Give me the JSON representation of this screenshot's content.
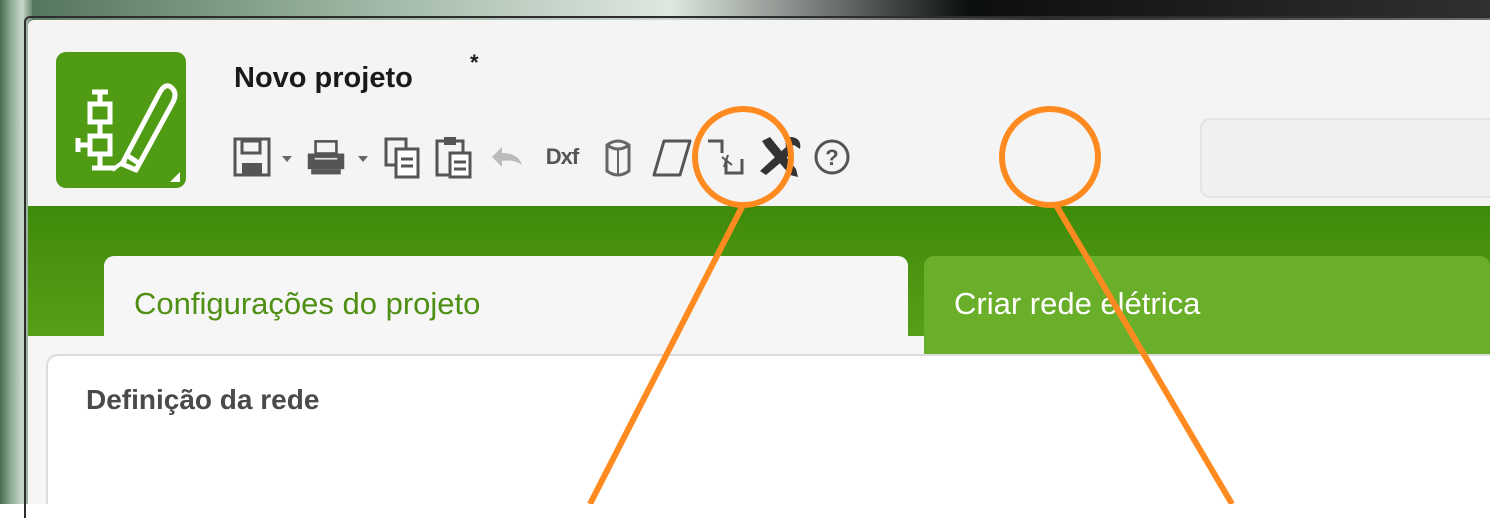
{
  "window": {
    "title": "Novo projeto",
    "modified_marker": "*"
  },
  "toolbar": {
    "items": [
      {
        "icon": "save-icon"
      },
      {
        "icon": "print-icon"
      },
      {
        "icon": "copy-icon"
      },
      {
        "icon": "paste-icon"
      },
      {
        "icon": "undo-icon"
      },
      {
        "icon": "dxf-icon",
        "label": "Dxf"
      },
      {
        "icon": "cylinder-icon"
      },
      {
        "icon": "parallelogram-icon"
      },
      {
        "icon": "transform-icon"
      },
      {
        "icon": "tools-icon"
      },
      {
        "icon": "help-icon",
        "label": "?"
      }
    ]
  },
  "tabs": [
    {
      "label": "Configurações do projeto",
      "active": true
    },
    {
      "label": "Criar rede elétrica",
      "active": false
    }
  ],
  "panel": {
    "title": "Definição da rede"
  },
  "colors": {
    "brand_green": "#4f9b14",
    "annotation_orange": "#ff8a1f",
    "active_tab_text": "#4f8f14"
  }
}
